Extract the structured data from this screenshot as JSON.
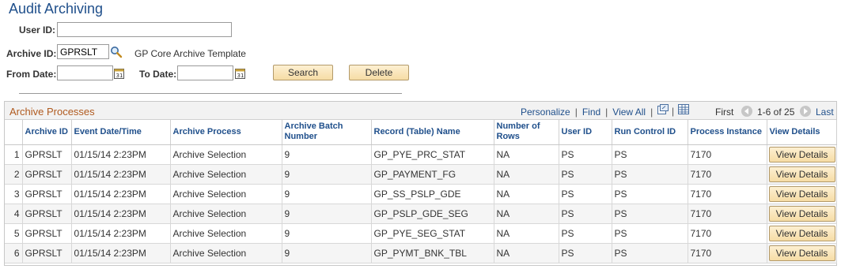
{
  "page": {
    "title": "Audit Archiving"
  },
  "form": {
    "user_id_label": "User ID:",
    "user_id_value": "",
    "archive_id_label": "Archive ID:",
    "archive_id_value": "GPRSLT",
    "archive_desc": "GP Core Archive Template",
    "from_date_label": "From Date:",
    "from_date_value": "",
    "to_date_label": "To Date:",
    "to_date_value": "",
    "search_label": "Search",
    "delete_label": "Delete"
  },
  "grid": {
    "title": "Archive Processes",
    "personalize": "Personalize",
    "find": "Find",
    "view_all": "View All",
    "first": "First",
    "range": "1-6 of 25",
    "last": "Last",
    "columns": [
      "Archive ID",
      "Event Date/Time",
      "Archive Process",
      "Archive Batch Number",
      "Record (Table) Name",
      "Number of Rows",
      "User ID",
      "Run Control ID",
      "Process Instance",
      "View Details"
    ],
    "rows": [
      {
        "num": "1",
        "archive_id": "GPRSLT",
        "event": "01/15/14  2:23PM",
        "process": "Archive Selection",
        "batch": "9",
        "record": "GP_PYE_PRC_STAT",
        "rows": "NA",
        "user": "PS",
        "runctl": "PS",
        "instance": "7170",
        "action": "View Details"
      },
      {
        "num": "2",
        "archive_id": "GPRSLT",
        "event": "01/15/14  2:23PM",
        "process": "Archive Selection",
        "batch": "9",
        "record": "GP_PAYMENT_FG",
        "rows": "NA",
        "user": "PS",
        "runctl": "PS",
        "instance": "7170",
        "action": "View Details"
      },
      {
        "num": "3",
        "archive_id": "GPRSLT",
        "event": "01/15/14  2:23PM",
        "process": "Archive Selection",
        "batch": "9",
        "record": "GP_SS_PSLP_GDE",
        "rows": "NA",
        "user": "PS",
        "runctl": "PS",
        "instance": "7170",
        "action": "View Details"
      },
      {
        "num": "4",
        "archive_id": "GPRSLT",
        "event": "01/15/14  2:23PM",
        "process": "Archive Selection",
        "batch": "9",
        "record": "GP_PSLP_GDE_SEG",
        "rows": "NA",
        "user": "PS",
        "runctl": "PS",
        "instance": "7170",
        "action": "View Details"
      },
      {
        "num": "5",
        "archive_id": "GPRSLT",
        "event": "01/15/14  2:23PM",
        "process": "Archive Selection",
        "batch": "9",
        "record": "GP_PYE_SEG_STAT",
        "rows": "NA",
        "user": "PS",
        "runctl": "PS",
        "instance": "7170",
        "action": "View Details"
      },
      {
        "num": "6",
        "archive_id": "GPRSLT",
        "event": "01/15/14  2:23PM",
        "process": "Archive Selection",
        "batch": "9",
        "record": "GP_PYMT_BNK_TBL",
        "rows": "NA",
        "user": "PS",
        "runctl": "PS",
        "instance": "7170",
        "action": "View Details"
      }
    ]
  },
  "icons": {
    "lookup": "magnifier-icon",
    "calendar": "calendar-icon",
    "zoom": "new-window-icon",
    "download": "grid-download-icon",
    "first": "previous-arrow-icon",
    "next": "next-arrow-icon"
  },
  "colors": {
    "title": "#1f4f8b",
    "grid_title": "#b05a1f",
    "button_bg": "#f6dca5",
    "link": "#1f4f8b"
  }
}
